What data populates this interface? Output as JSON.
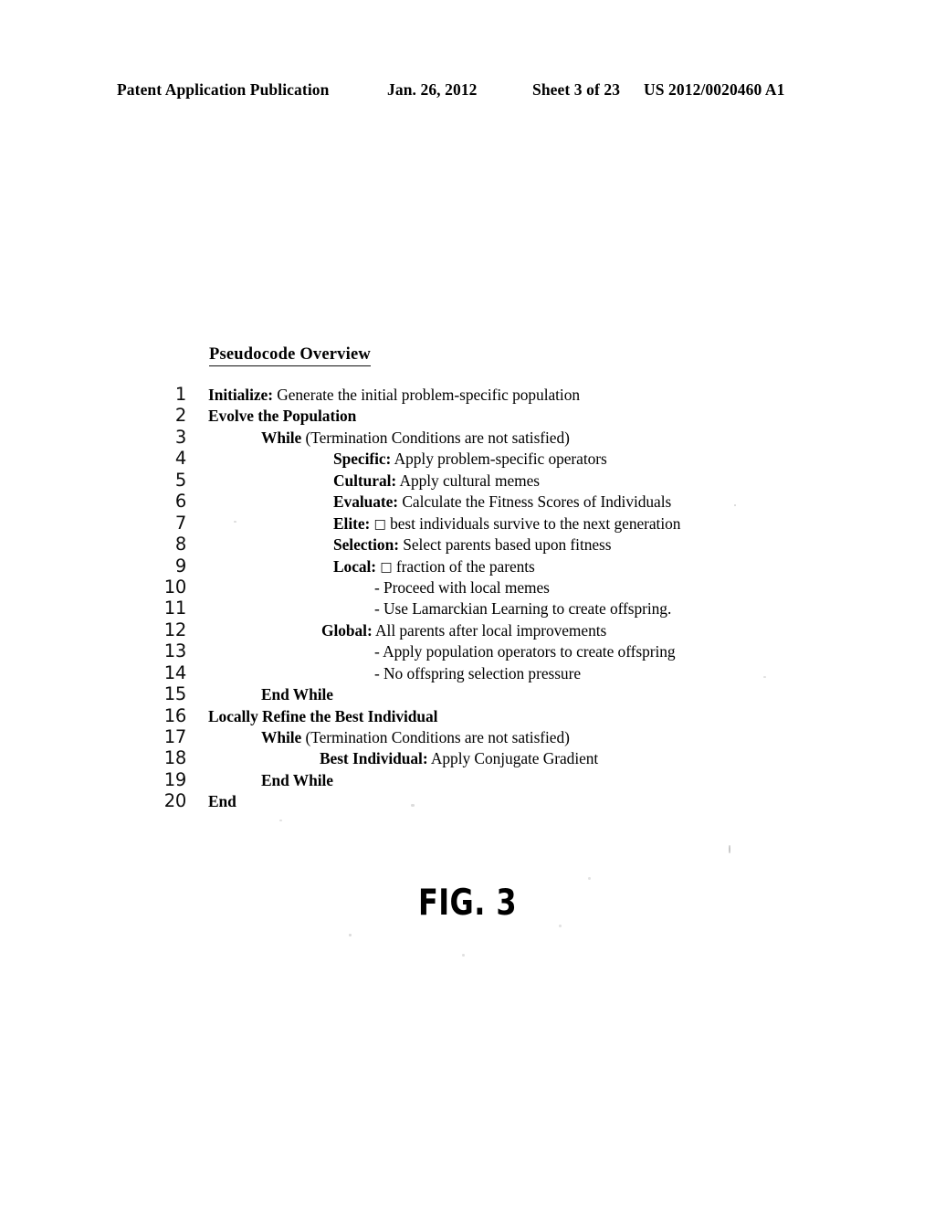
{
  "header": {
    "publication": "Patent Application Publication",
    "date": "Jan. 26, 2012",
    "sheet": "Sheet 3 of 23",
    "patent_number": "US 2012/0020460 A1"
  },
  "figure": {
    "title": "Pseudocode Overview",
    "caption": "FIG. 3"
  },
  "pseudocode": {
    "lines": [
      {
        "number": "1",
        "indent": "i0",
        "bold": "Initialize:",
        "text": " Generate the initial problem-specific population"
      },
      {
        "number": "2",
        "indent": "i0",
        "bold": "Evolve the Population",
        "text": ""
      },
      {
        "number": "3",
        "indent": "i1",
        "bold": "While",
        "text": " (Termination Conditions are not satisfied)"
      },
      {
        "number": "4",
        "indent": "i3",
        "bold": "Specific:",
        "text": " Apply problem-specific operators"
      },
      {
        "number": "5",
        "indent": "i3",
        "bold": "Cultural:",
        "text": " Apply cultural memes"
      },
      {
        "number": "6",
        "indent": "i3",
        "bold": "Evaluate:",
        "text": " Calculate the Fitness Scores of Individuals"
      },
      {
        "number": "7",
        "indent": "i3",
        "bold": "Elite:",
        "text": " □ best individuals survive to the next generation"
      },
      {
        "number": "8",
        "indent": "i3",
        "bold": "Selection:",
        "text": " Select parents based upon fitness"
      },
      {
        "number": "9",
        "indent": "i3",
        "bold": "Local:",
        "text": " □ fraction of the parents"
      },
      {
        "number": "10",
        "indent": "i4",
        "bold": "",
        "text": "- Proceed with local memes"
      },
      {
        "number": "11",
        "indent": "i4",
        "bold": "",
        "text": "- Use Lamarckian Learning to create offspring."
      },
      {
        "number": "12",
        "indent": "i2",
        "bold": "Global:",
        "text": " All parents after local improvements"
      },
      {
        "number": "13",
        "indent": "i4",
        "bold": "",
        "text": "- Apply population operators to create offspring"
      },
      {
        "number": "14",
        "indent": "i4",
        "bold": "",
        "text": "- No offspring selection pressure"
      },
      {
        "number": "15",
        "indent": "i1",
        "bold": "End While",
        "text": ""
      },
      {
        "number": "16",
        "indent": "i0",
        "bold": "Locally Refine the Best Individual",
        "text": ""
      },
      {
        "number": "17",
        "indent": "i1",
        "bold": "While",
        "text": " (Termination Conditions are not satisfied)"
      },
      {
        "number": "18",
        "indent": "i5",
        "bold": "Best Individual:",
        "text": " Apply Conjugate Gradient"
      },
      {
        "number": "19",
        "indent": "i1",
        "bold": "End While",
        "text": ""
      },
      {
        "number": "20",
        "indent": "i0",
        "bold": "End",
        "text": ""
      }
    ]
  }
}
